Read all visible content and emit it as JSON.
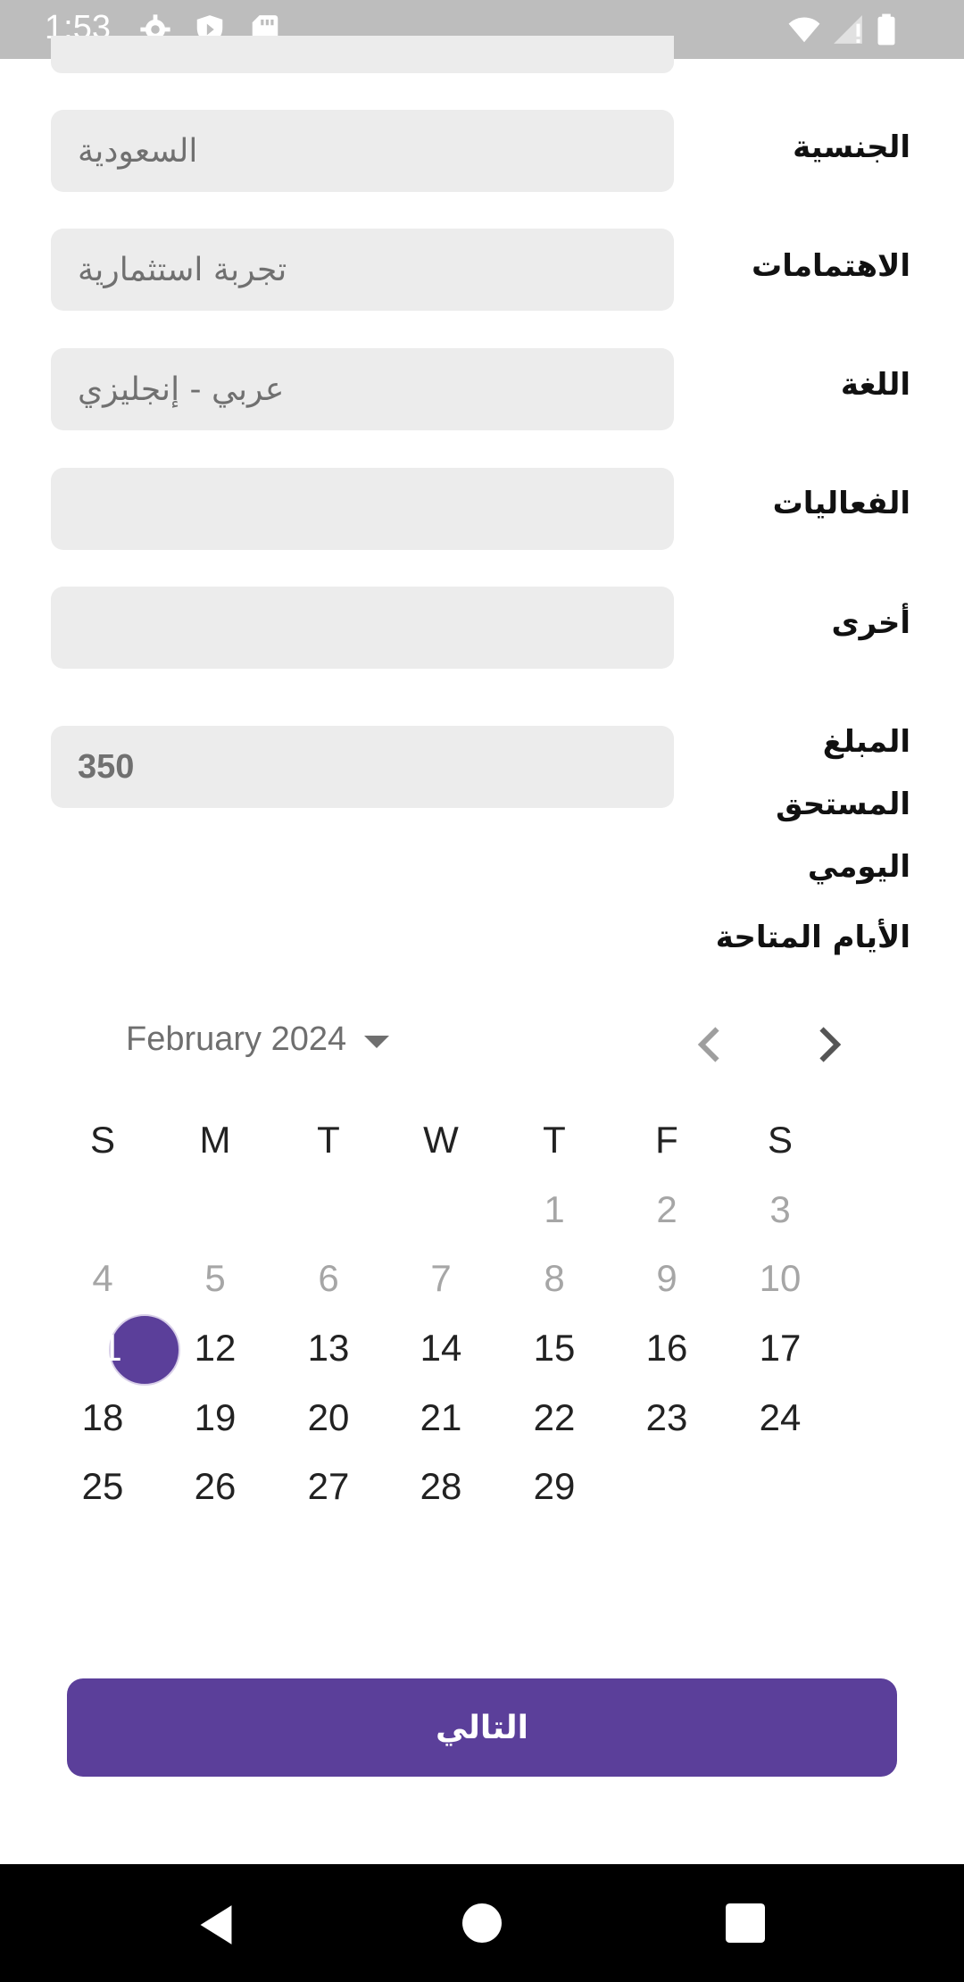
{
  "status_bar": {
    "time": "1:53"
  },
  "form": {
    "rows": [
      {
        "label": "الجنسية",
        "value": "السعودية"
      },
      {
        "label": "الاهتمامات",
        "value": "تجربة استثمارية"
      },
      {
        "label": "اللغة",
        "value": "عربي - إنجليزي"
      },
      {
        "label": "الفعاليات",
        "value": ""
      },
      {
        "label": "أخرى",
        "value": ""
      },
      {
        "label": "المبلغ المستحق اليومي",
        "value": "350"
      }
    ],
    "available_days_title": "الأيام المتاحة"
  },
  "calendar": {
    "month_label": "February 2024",
    "weekdays": [
      "S",
      "M",
      "T",
      "W",
      "T",
      "F",
      "S"
    ],
    "selected_day": "11",
    "weeks": [
      [
        "",
        "",
        "",
        "",
        "1",
        "2",
        "3"
      ],
      [
        "4",
        "5",
        "6",
        "7",
        "8",
        "9",
        "10"
      ],
      [
        "11",
        "12",
        "13",
        "14",
        "15",
        "16",
        "17"
      ],
      [
        "18",
        "19",
        "20",
        "21",
        "22",
        "23",
        "24"
      ],
      [
        "25",
        "26",
        "27",
        "28",
        "29",
        "",
        ""
      ]
    ],
    "disabled_days": [
      "1",
      "2",
      "3",
      "4",
      "5",
      "6",
      "7",
      "8",
      "9",
      "10"
    ]
  },
  "buttons": {
    "next_label": "التالي"
  },
  "colors": {
    "accent": "#5b3f9a",
    "field_bg": "#ececec",
    "status_bar": "#bdbdbd"
  }
}
